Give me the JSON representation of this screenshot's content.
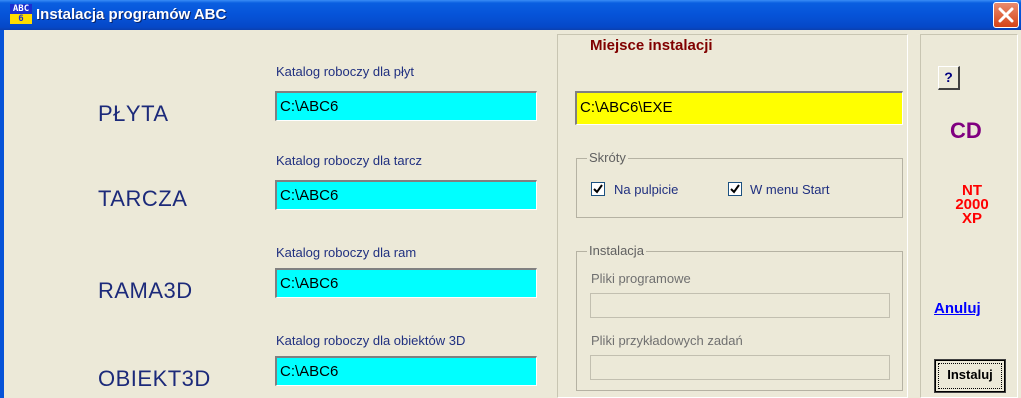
{
  "window": {
    "title": "Instalacja programów ABC",
    "icon_top": "ABC",
    "icon_bottom": "6"
  },
  "products": [
    {
      "name": "PŁYTA",
      "dir_label": "Katalog roboczy dla płyt",
      "dir_value": "C:\\ABC6"
    },
    {
      "name": "TARCZA",
      "dir_label": "Katalog roboczy dla tarcz",
      "dir_value": "C:\\ABC6"
    },
    {
      "name": "RAMA3D",
      "dir_label": "Katalog roboczy dla ram",
      "dir_value": "C:\\ABC6"
    },
    {
      "name": "OBIEKT3D",
      "dir_label": "Katalog roboczy dla obiektów 3D",
      "dir_value": "C:\\ABC6"
    }
  ],
  "install": {
    "dest_label": "Miejsce instalacji",
    "dest_value": "C:\\ABC6\\EXE"
  },
  "shortcuts": {
    "title": "Skróty",
    "desktop_label": "Na pulpicie",
    "desktop_checked": true,
    "start_menu_label": "W menu Start",
    "start_menu_checked": true
  },
  "progress": {
    "title": "Instalacja",
    "program_files_label": "Pliki programowe",
    "example_files_label": "Pliki przykładowych zadań"
  },
  "side": {
    "help_label": "?",
    "cd_label": "CD",
    "os_lines": [
      "NT",
      "2000",
      "XP"
    ],
    "cancel_label": "Anuluj",
    "install_label": "Instaluj"
  },
  "colors": {
    "field_cyan": "#00ffff",
    "field_yellow": "#ffff00",
    "dest_label": "#800000",
    "cd_label": "#800080",
    "os_label": "#ff0000",
    "link": "#0000ff"
  }
}
